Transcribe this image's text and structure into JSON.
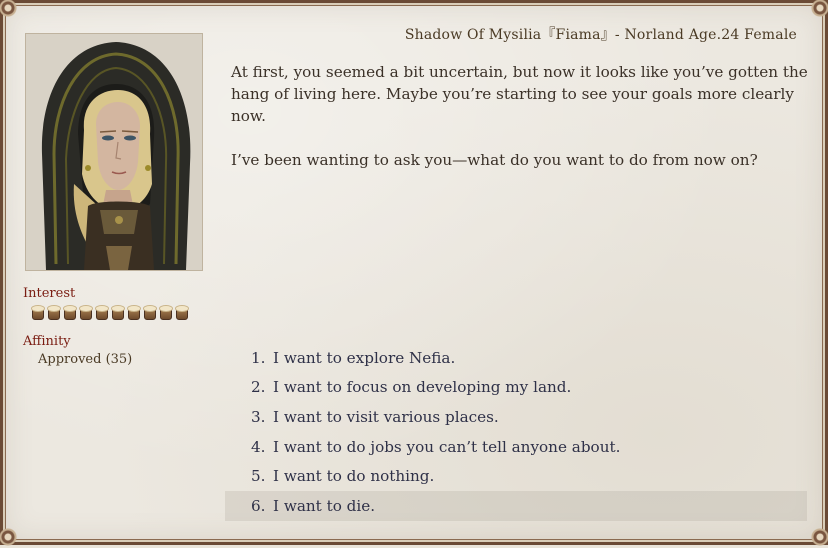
{
  "header": {
    "character_info": "Shadow Of Mysilia『Fiama』- Norland Age.24 Female"
  },
  "portrait": {
    "icon": "hooded-woman-portrait"
  },
  "stats": {
    "interest_label": "Interest",
    "interest_level": 10,
    "interest_icon": "mug-icon",
    "affinity_label": "Affinity",
    "affinity_value": "Approved (35)"
  },
  "dialogue": {
    "paragraphs": [
      "At first, you seemed a bit uncertain, but now it looks like you’ve gotten the hang of living here. Maybe you’re starting to see your goals more clearly now.",
      "I’ve been wanting to ask you—what do you want to do from now on?"
    ]
  },
  "choices": [
    {
      "number": "1.",
      "text": "I want to explore Nefia."
    },
    {
      "number": "2.",
      "text": "I want to focus on developing my land."
    },
    {
      "number": "3.",
      "text": "I want to visit various places."
    },
    {
      "number": "4.",
      "text": "I want to do jobs you can’t tell anyone about."
    },
    {
      "number": "5.",
      "text": "I want to do nothing."
    },
    {
      "number": "6.",
      "text": "I want to die."
    }
  ],
  "selected_choice": 6
}
